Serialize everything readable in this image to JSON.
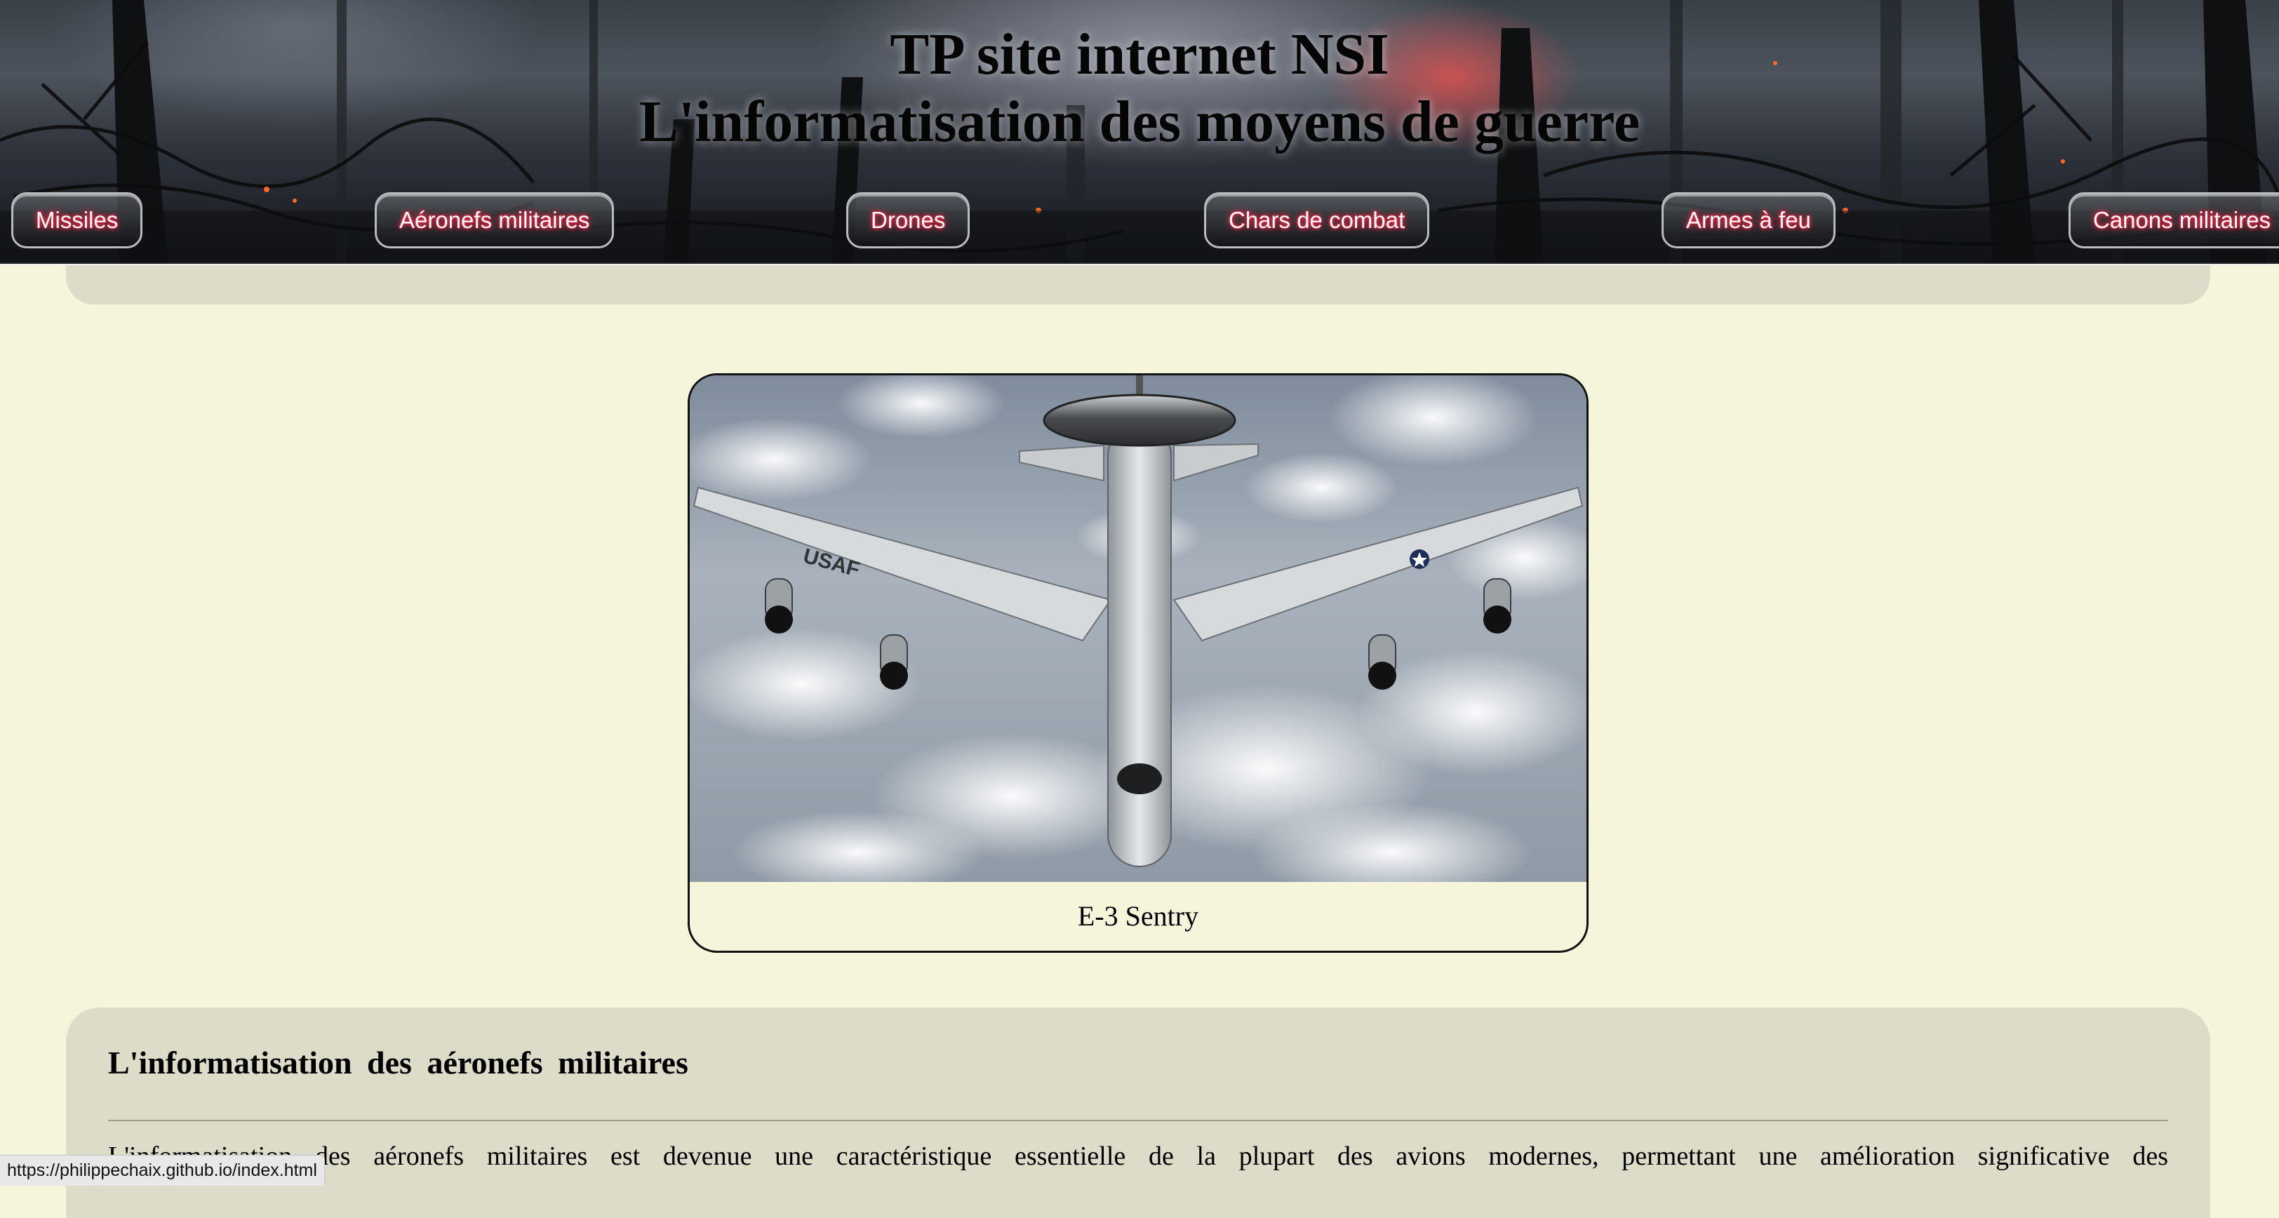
{
  "header": {
    "title_line1": "TP site internet NSI",
    "title_line2": "L'informatisation des moyens de guerre"
  },
  "nav": {
    "items": [
      {
        "label": "Missiles"
      },
      {
        "label": "Aéronefs militaires"
      },
      {
        "label": "Drones"
      },
      {
        "label": "Chars de combat"
      },
      {
        "label": "Armes à feu"
      },
      {
        "label": "Canons militaires"
      }
    ]
  },
  "figure": {
    "caption": "E-3 Sentry",
    "aircraft_marking": "USAF"
  },
  "article": {
    "heading": "L'informatisation des aéronefs militaires",
    "text": "L'informatisation des aéronefs militaires est devenue une caractéristique essentielle de la plupart des avions modernes, permettant une amélioration significative des"
  },
  "status_bar": {
    "url": "https://philippechaix.github.io/index.html"
  },
  "colors": {
    "page_background": "#f5f5dc",
    "panel_background": "#dcdcc8",
    "nav_text_glow": "#ff2a4a"
  }
}
